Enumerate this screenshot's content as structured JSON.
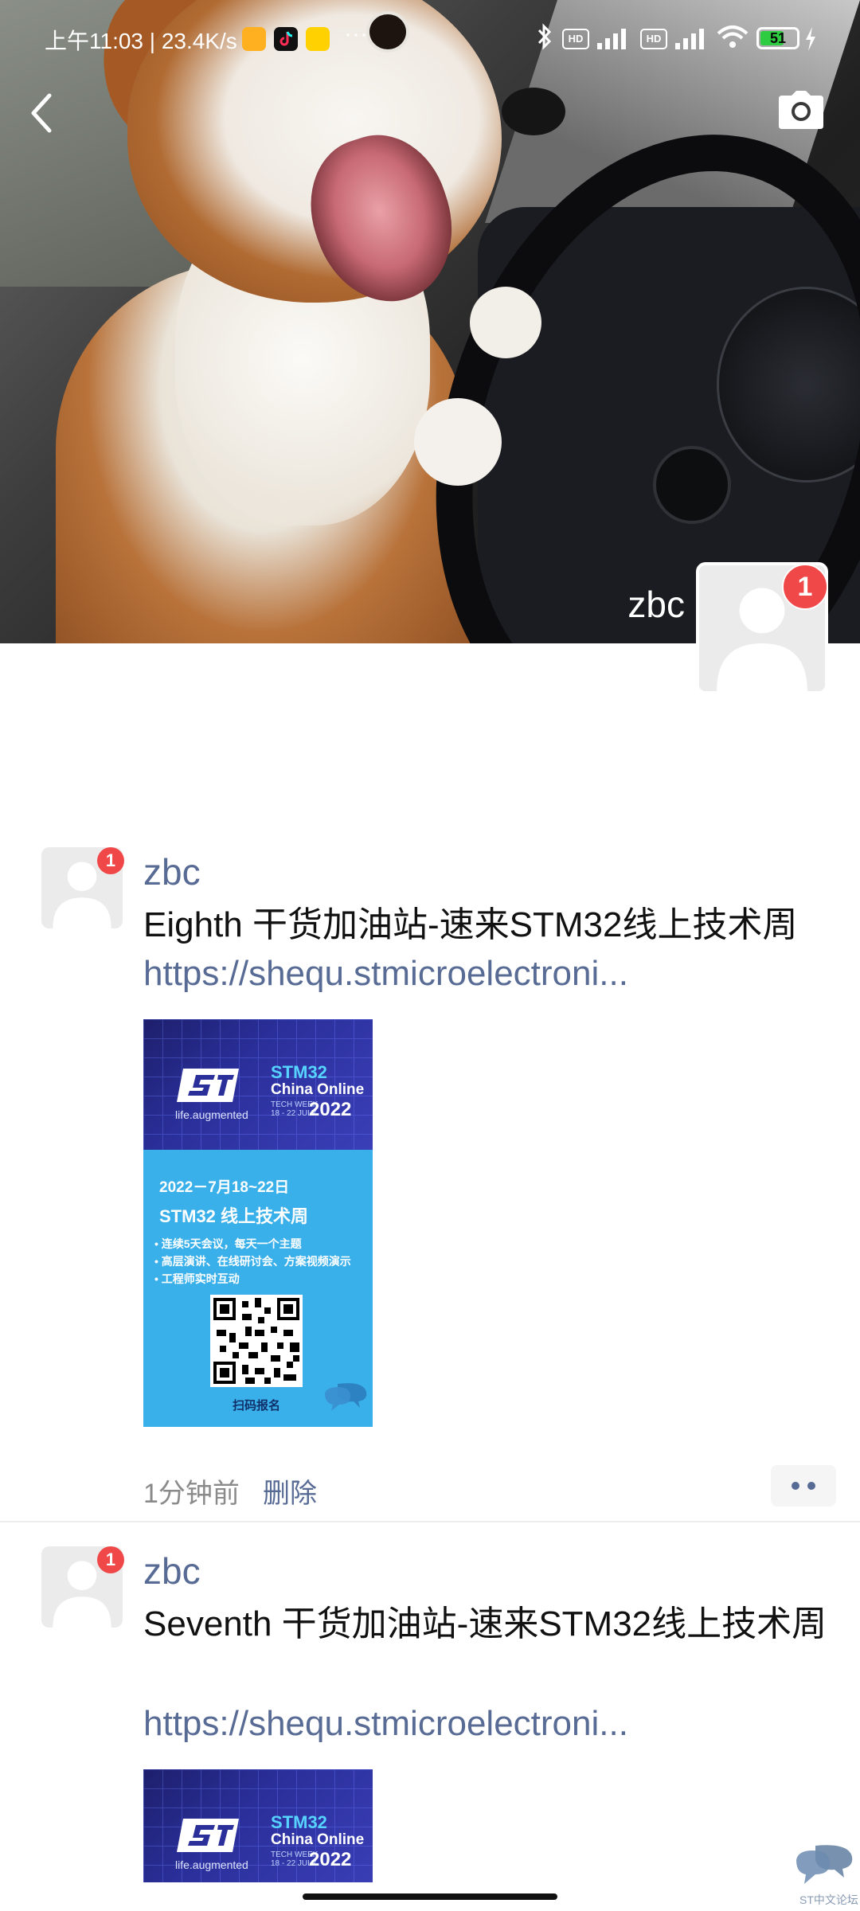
{
  "status_bar": {
    "time": "上午11:03",
    "speed": "23.4K/s",
    "more": "···",
    "battery": "51"
  },
  "cover": {
    "username": "zbc"
  },
  "profile": {
    "badge_count": "1"
  },
  "posts": [
    {
      "name": "zbc",
      "badge": "1",
      "text": "Eighth  干货加油站-速来STM32线上技术周",
      "link": "https://shequ.stmicroelectroni...",
      "time": "1分钟前",
      "delete": "删除"
    },
    {
      "name": "zbc",
      "badge": "1",
      "text": "Seventh  干货加油站-速来STM32线上技术周",
      "link": "https://shequ.stmicroelectroni..."
    }
  ],
  "poster": {
    "tagline": "life.augmented",
    "stm": "STM32",
    "china_online": "China Online",
    "tech_week": "TECH WEEK 18 - 22 JULY",
    "year": "2022",
    "date": "2022－7月18~22日",
    "title": "STM32 线上技术周",
    "bullets": [
      "• 连续5天会议，每天一个主题",
      "• 高层演讲、在线研讨会、方案视频演示",
      "• 工程师实时互动"
    ],
    "scan": "扫码报名"
  },
  "watermark": {
    "text": "ST中文论坛"
  },
  "icons": {
    "back": "chevron-left-icon",
    "camera": "camera-icon",
    "bluetooth": "bluetooth-icon",
    "wifi": "wifi-icon",
    "signal": "signal-icon"
  },
  "colors": {
    "link_blue": "#576b95",
    "badge_red": "#f04848",
    "poster_blue": "#3ab0ea"
  }
}
